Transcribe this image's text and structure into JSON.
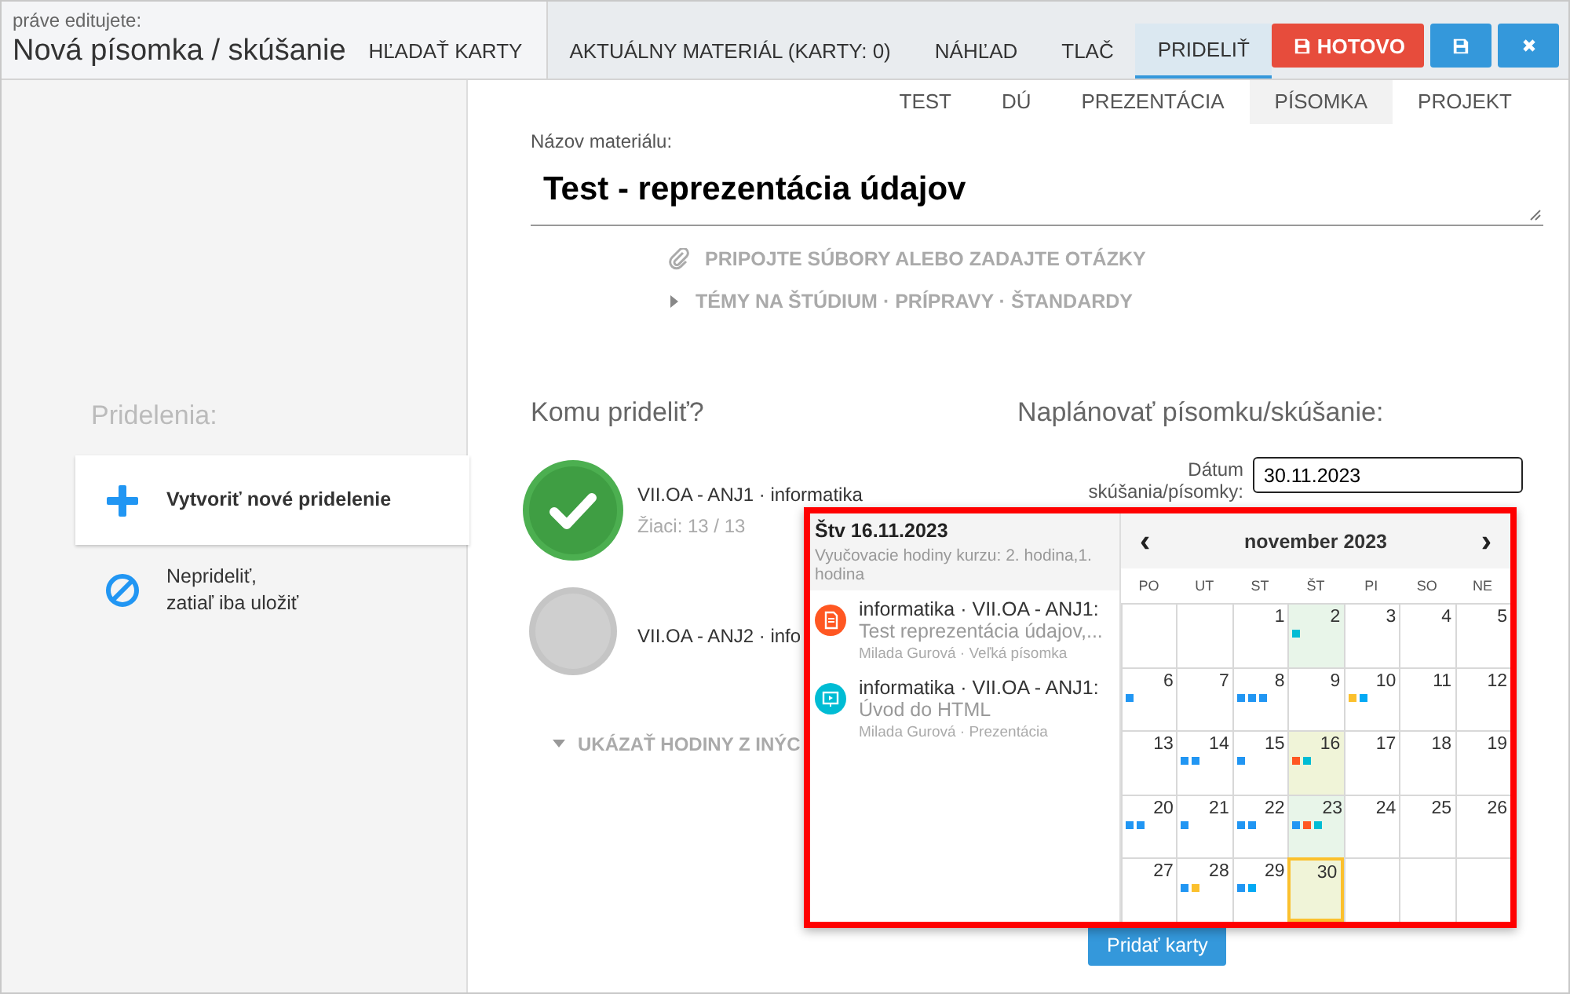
{
  "header": {
    "caption": "práve editujete:",
    "title": "Nová písomka / skúšanie"
  },
  "tabs": [
    {
      "label": "HĽADAŤ KARTY",
      "selected": false
    },
    {
      "label": "AKTUÁLNY MATERIÁL (KARTY: 0)",
      "selected": false
    },
    {
      "label": "NÁHĽAD",
      "selected": false
    },
    {
      "label": "TLAČ",
      "selected": false
    },
    {
      "label": "PRIDELIŤ",
      "selected": true
    }
  ],
  "actions": [
    {
      "kind": "done",
      "label": "HOTOVO"
    },
    {
      "kind": "save"
    },
    {
      "kind": "close"
    }
  ],
  "type_tabs": [
    {
      "label": "TEST",
      "selected": false
    },
    {
      "label": "DÚ",
      "selected": false
    },
    {
      "label": "PREZENTÁCIA",
      "selected": false
    },
    {
      "label": "PÍSOMKA",
      "selected": true
    },
    {
      "label": "PROJEKT",
      "selected": false
    }
  ],
  "material": {
    "label": "Názov materiálu:",
    "value": "Test - reprezentácia údajov"
  },
  "links": [
    {
      "kind": "attach",
      "label": "PRIPOJTE SÚBORY ALEBO ZADAJTE OTÁZKY"
    },
    {
      "kind": "expand",
      "label": "TÉMY NA ŠTÚDIUM · PRÍPRAVY · ŠTANDARDY"
    }
  ],
  "sidebar": {
    "heading": "Pridelenia:",
    "items": [
      {
        "kind": "create",
        "label": "Vytvoriť nové pridelenie",
        "selected": true
      },
      {
        "kind": "none",
        "label": "Neprideliť,\nzatiaľ iba uložiť",
        "selected": false
      }
    ]
  },
  "assign": {
    "heading": "Komu prideliť?",
    "classes": [
      {
        "name": "VII.OA - ANJ1 · informatika",
        "students": "Žiaci: 13 / 13",
        "selected": true
      },
      {
        "name": "VII.OA - ANJ2 · info",
        "selected": false
      }
    ],
    "more": "UKÁZAŤ HODINY Z INÝC"
  },
  "schedule": {
    "heading": "Naplánovať písomku/skúšanie:",
    "date_label": "Dátum skúšania/písomky:",
    "date_value": "30.11.2023",
    "button": "Pridať karty"
  },
  "popup": {
    "day_title": "Štv 16.11.2023",
    "day_info": "Vyučovacie hodiny kurzu: 2. hodina,1. hodina",
    "events": [
      {
        "kind": "exam",
        "color": "#ff5722",
        "title": "informatika · VII.OA - ANJ1:",
        "name": "Test reprezentácia údajov,...",
        "meta": "Milada Gurová · Veľká písomka"
      },
      {
        "kind": "presentation",
        "color": "#00bcd4",
        "title": "informatika · VII.OA - ANJ1:",
        "name": "Úvod do HTML",
        "meta": "Milada Gurová · Prezentácia"
      }
    ],
    "month": "november 2023",
    "prev": "‹",
    "next": "›",
    "weekdays": [
      "PO",
      "UT",
      "ST",
      "ŠT",
      "PI",
      "SO",
      "NE"
    ],
    "weeks": [
      {
        "days": [
          {
            "day": "1"
          },
          {
            "day": "2",
            "exam": true,
            "dots": [
              {
                "color": "#00bcd4"
              }
            ]
          },
          {
            "day": "3"
          },
          {
            "day": "4"
          },
          {
            "day": "5"
          }
        ]
      },
      {
        "days": [
          {
            "day": "6",
            "dots": [
              {
                "color": "#2196f3"
              }
            ]
          },
          {
            "day": "7"
          },
          {
            "day": "8",
            "dots": [
              {
                "color": "#2196f3"
              },
              {
                "color": "#2196f3"
              },
              {
                "color": "#2196f3"
              }
            ]
          },
          {
            "day": "9"
          },
          {
            "day": "10",
            "dots": [
              {
                "color": "#fbc02d"
              },
              {
                "color": "#03a9f4"
              }
            ]
          },
          {
            "day": "11"
          },
          {
            "day": "12"
          }
        ]
      },
      {
        "days": [
          {
            "day": "13"
          },
          {
            "day": "14",
            "dots": [
              {
                "color": "#2196f3"
              },
              {
                "color": "#2196f3"
              }
            ]
          },
          {
            "day": "15",
            "dots": [
              {
                "color": "#2196f3"
              }
            ]
          },
          {
            "day": "16",
            "shown": true,
            "dots": [
              {
                "color": "#ff5722"
              },
              {
                "color": "#00bcd4"
              }
            ]
          },
          {
            "day": "17"
          },
          {
            "day": "18"
          },
          {
            "day": "19"
          }
        ]
      },
      {
        "days": [
          {
            "day": "20",
            "dots": [
              {
                "color": "#2196f3"
              },
              {
                "color": "#2196f3"
              }
            ]
          },
          {
            "day": "21",
            "dots": [
              {
                "color": "#2196f3"
              }
            ]
          },
          {
            "day": "22",
            "dots": [
              {
                "color": "#2196f3"
              },
              {
                "color": "#2196f3"
              }
            ]
          },
          {
            "day": "23",
            "exam": true,
            "dots": [
              {
                "color": "#2196f3"
              },
              {
                "color": "#ff5722"
              },
              {
                "color": "#00bcd4"
              }
            ]
          },
          {
            "day": "24"
          },
          {
            "day": "25"
          },
          {
            "day": "26"
          }
        ]
      },
      {
        "days": [
          {
            "day": "27"
          },
          {
            "day": "28",
            "dots": [
              {
                "color": "#2196f3"
              },
              {
                "color": "#fbc02d"
              }
            ]
          },
          {
            "day": "29",
            "dots": [
              {
                "color": "#2196f3"
              },
              {
                "color": "#03a9f4"
              }
            ]
          },
          {
            "day": "30",
            "selected": true
          }
        ]
      }
    ]
  }
}
